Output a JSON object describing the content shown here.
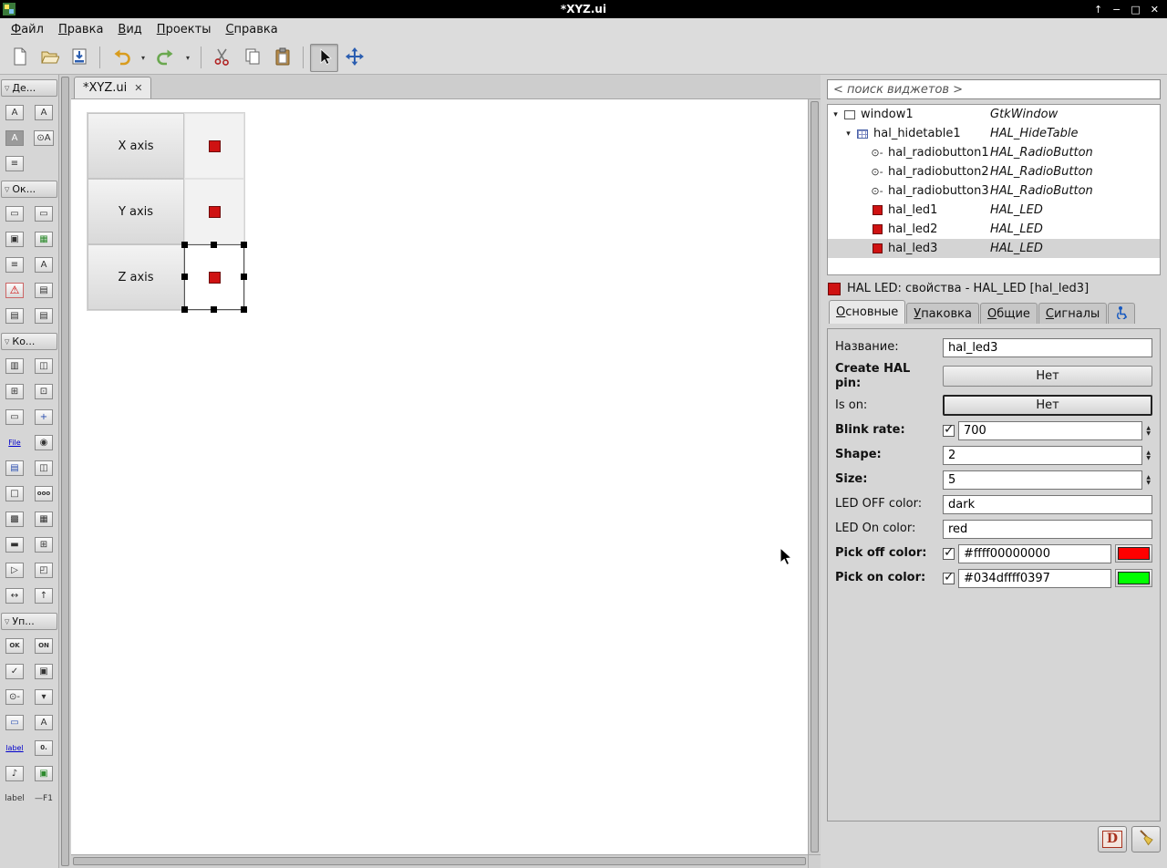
{
  "titlebar": {
    "title": "*XYZ.ui",
    "controls": [
      {
        "name": "shade-window-button",
        "glyph": "↑"
      },
      {
        "name": "minimize-window-button",
        "glyph": "−"
      },
      {
        "name": "maximize-window-button",
        "glyph": "□"
      },
      {
        "name": "close-window-button",
        "glyph": "✕"
      }
    ]
  },
  "menubar": {
    "items": [
      {
        "label": "Файл"
      },
      {
        "label": "Правка"
      },
      {
        "label": "Вид"
      },
      {
        "label": "Проекты"
      },
      {
        "label": "Справка"
      }
    ]
  },
  "toolbar": {
    "buttons": [
      "new-file",
      "open-file",
      "save-file",
      "undo",
      "undo-history",
      "redo",
      "redo-history",
      "cut",
      "copy",
      "paste",
      "select-widgets",
      "drag-resize"
    ]
  },
  "palette": {
    "collapse_glyph": "▽",
    "sections": [
      {
        "label": "Де...",
        "items": [
          {
            "name": "action",
            "glyph": "A"
          },
          {
            "name": "named-action",
            "glyph": "A"
          },
          {
            "name": "toggle-action",
            "glyph": "A",
            "cls": "inv"
          },
          {
            "name": "radio-action",
            "glyph": "⊙A"
          },
          {
            "name": "recent-manager",
            "glyph": "≡"
          }
        ]
      },
      {
        "label": "Ок...",
        "items": [
          {
            "name": "window",
            "glyph": "▭"
          },
          {
            "name": "dialog",
            "glyph": "▭"
          },
          {
            "name": "about-dialog",
            "glyph": "▣"
          },
          {
            "name": "color-selection-dialog",
            "glyph": "▦",
            "cls": "green"
          },
          {
            "name": "recent-chooser-dialog",
            "glyph": "≡"
          },
          {
            "name": "font-selection-dialog",
            "glyph": "A"
          },
          {
            "name": "warning-dialog",
            "glyph": "⚠",
            "cls": "warn"
          },
          {
            "name": "message-dialog",
            "glyph": "▤"
          },
          {
            "name": "file-chooser-dialog",
            "glyph": "▤"
          },
          {
            "name": "assistant",
            "glyph": "▤"
          }
        ]
      },
      {
        "label": "Ко...",
        "items": [
          {
            "name": "box",
            "glyph": "▥"
          },
          {
            "name": "paned",
            "glyph": "◫"
          },
          {
            "name": "grid",
            "glyph": "⊞"
          },
          {
            "name": "notebook",
            "glyph": "⊡"
          },
          {
            "name": "frame",
            "glyph": "▭"
          },
          {
            "name": "fixed",
            "glyph": "+",
            "cls": "blue"
          },
          {
            "name": "file-chooser-button",
            "glyph": "File",
            "cls": "link"
          },
          {
            "name": "radio-group",
            "glyph": "◉"
          },
          {
            "name": "toolbar",
            "glyph": "▤",
            "cls": "blue"
          },
          {
            "name": "hpaned",
            "glyph": "◫"
          },
          {
            "name": "layout",
            "glyph": "□"
          },
          {
            "name": "button-box",
            "glyph": "ooo",
            "cls": "mini"
          },
          {
            "name": "scrolled-window",
            "glyph": "▩"
          },
          {
            "name": "viewport",
            "glyph": "▦"
          },
          {
            "name": "menu-bar",
            "glyph": "▬"
          },
          {
            "name": "table",
            "glyph": "⊞"
          },
          {
            "name": "expander",
            "glyph": "▷"
          },
          {
            "name": "aspect-frame",
            "glyph": "◰"
          },
          {
            "name": "size-group",
            "glyph": "↔"
          },
          {
            "name": "alignment",
            "glyph": "↑"
          }
        ]
      },
      {
        "label": "Уп...",
        "items": [
          {
            "name": "button",
            "glyph": "OK",
            "cls": "mini"
          },
          {
            "name": "toggle-button",
            "glyph": "ON",
            "cls": "mini"
          },
          {
            "name": "check-button",
            "glyph": "✓"
          },
          {
            "name": "switch",
            "glyph": "▣"
          },
          {
            "name": "radio-button",
            "glyph": "⊙-"
          },
          {
            "name": "combo-box",
            "glyph": "▾"
          },
          {
            "name": "entry",
            "glyph": "▭",
            "cls": "blue"
          },
          {
            "name": "accel-label",
            "glyph": "A"
          },
          {
            "name": "link-button",
            "glyph": "label",
            "cls": "link"
          },
          {
            "name": "spin-button",
            "glyph": "0.",
            "cls": "mini"
          },
          {
            "name": "volume-button",
            "glyph": "♪"
          },
          {
            "name": "image",
            "glyph": "▣",
            "cls": "green"
          },
          {
            "name": "text-label",
            "glyph": "label",
            "cls": "plain"
          },
          {
            "name": "f1-help-label",
            "glyph": "—F1",
            "cls": "plain"
          }
        ]
      }
    ]
  },
  "editor": {
    "tab_label": "*XYZ.ui",
    "close_glyph": "✕"
  },
  "design": {
    "led_color": "#cf1212",
    "rows": [
      {
        "label": "X axis"
      },
      {
        "label": "Y axis"
      },
      {
        "label": "Z axis",
        "led_class": "selected"
      }
    ]
  },
  "inspector": {
    "search_placeholder": "< поиск виджетов >",
    "rows": [
      {
        "name": "window1",
        "klass": "GtkWindow",
        "icon": "window-icon",
        "depth_class": "d0",
        "expander": "▾"
      },
      {
        "name": "hal_hidetable1",
        "klass": "HAL_HideTable",
        "icon": "table-icon",
        "depth_class": "d1",
        "expander": "▾"
      },
      {
        "name": "hal_radiobutton1",
        "klass": "HAL_RadioButton",
        "icon": "radio-icon",
        "depth_class": "d2"
      },
      {
        "name": "hal_radiobutton2",
        "klass": "HAL_RadioButton",
        "icon": "radio-icon",
        "depth_class": "d2"
      },
      {
        "name": "hal_radiobutton3",
        "klass": "HAL_RadioButton",
        "icon": "radio-icon",
        "depth_class": "d2"
      },
      {
        "name": "hal_led1",
        "klass": "HAL_LED",
        "icon": "led-icon",
        "depth_class": "d2"
      },
      {
        "name": "hal_led2",
        "klass": "HAL_LED",
        "icon": "led-icon",
        "depth_class": "d2"
      },
      {
        "name": "hal_led3",
        "klass": "HAL_LED",
        "icon": "led-icon",
        "depth_class": "d2",
        "row_class": "selected"
      }
    ]
  },
  "properties": {
    "header": "HAL LED: свойства - HAL_LED [hal_led3]",
    "tabs": [
      {
        "label": "Основные"
      },
      {
        "label": "Упаковка"
      },
      {
        "label": "Общие"
      },
      {
        "label": "Сигналы"
      }
    ],
    "fields": {
      "name": {
        "label": "Название:",
        "value": "hal_led3"
      },
      "create_pin": {
        "label": "Create HAL pin:",
        "value": "Нет"
      },
      "is_on": {
        "label": "Is on:",
        "value": "Нет"
      },
      "blink": {
        "label": "Blink rate:",
        "value": "700",
        "checked": true
      },
      "shape": {
        "label": "Shape:",
        "value": "2"
      },
      "size": {
        "label": "Size:",
        "value": "5"
      },
      "led_off": {
        "label": "LED OFF color:",
        "value": "dark"
      },
      "led_on": {
        "label": "LED On color:",
        "value": "red"
      },
      "pick_off": {
        "label": "Pick off color:",
        "value": "#ffff00000000",
        "checked": true,
        "swatch_color": "#ff0000"
      },
      "pick_on": {
        "label": "Pick on color:",
        "value": "#034dffff0397",
        "checked": true,
        "swatch_color": "#00ff00"
      }
    }
  },
  "footer": {
    "devhelp_label": "D",
    "buttons": [
      "devhelp",
      "cleanup-project"
    ]
  }
}
